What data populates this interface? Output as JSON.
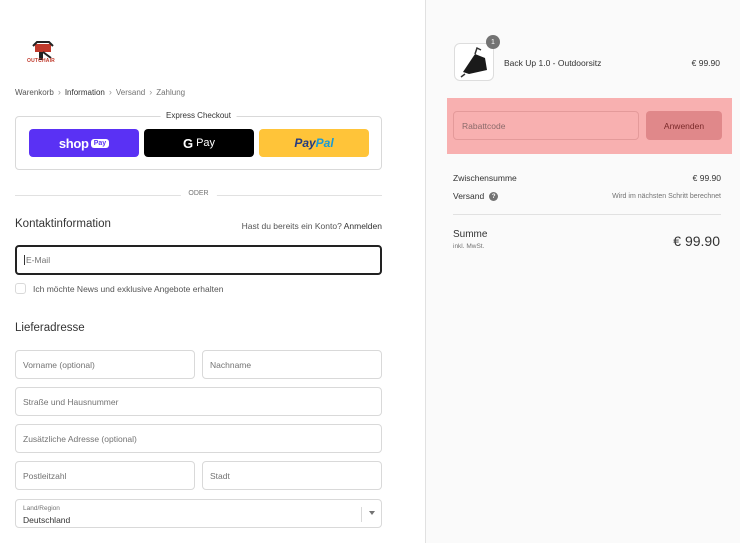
{
  "brand": {
    "name": "OUTCHAIR",
    "accent": "#c0392b"
  },
  "breadcrumb": [
    {
      "label": "Warenkorb"
    },
    {
      "label": "Information"
    },
    {
      "label": "Versand"
    },
    {
      "label": "Zahlung"
    }
  ],
  "express": {
    "title": "Express Checkout",
    "shop_pay": {
      "text": "shop",
      "badge": "Pay"
    },
    "gpay": {
      "g": "G",
      "text": "Pay"
    },
    "paypal": {
      "part1": "Pay",
      "part2": "Pal"
    }
  },
  "divider_text": "ODER",
  "contact": {
    "title": "Kontaktinformation",
    "login_prompt": "Hast du bereits ein Konto?",
    "login_link": "Anmelden",
    "email_placeholder": "E-Mail",
    "newsletter_label": "Ich möchte News und exklusive Angebote erhalten"
  },
  "shipping": {
    "title": "Lieferadresse",
    "first_name_placeholder": "Vorname (optional)",
    "last_name_placeholder": "Nachname",
    "street_placeholder": "Straße und Hausnummer",
    "address2_placeholder": "Zusätzliche Adresse (optional)",
    "zip_placeholder": "Postleitzahl",
    "city_placeholder": "Stadt",
    "country_label": "Land/Region",
    "country_value": "Deutschland"
  },
  "cart": {
    "item": {
      "quantity": "1",
      "name": "Back Up 1.0 - Outdoorsitz",
      "price": "€ 99.90"
    },
    "discount_placeholder": "Rabattcode",
    "discount_button": "Anwenden",
    "subtotal_label": "Zwischensumme",
    "subtotal_value": "€ 99.90",
    "shipping_label": "Versand",
    "shipping_help": "?",
    "shipping_value": "Wird im nächsten Schritt berechnet",
    "total_label": "Summe",
    "total_sub": "inkl. MwSt.",
    "total_value": "€ 99.90"
  }
}
